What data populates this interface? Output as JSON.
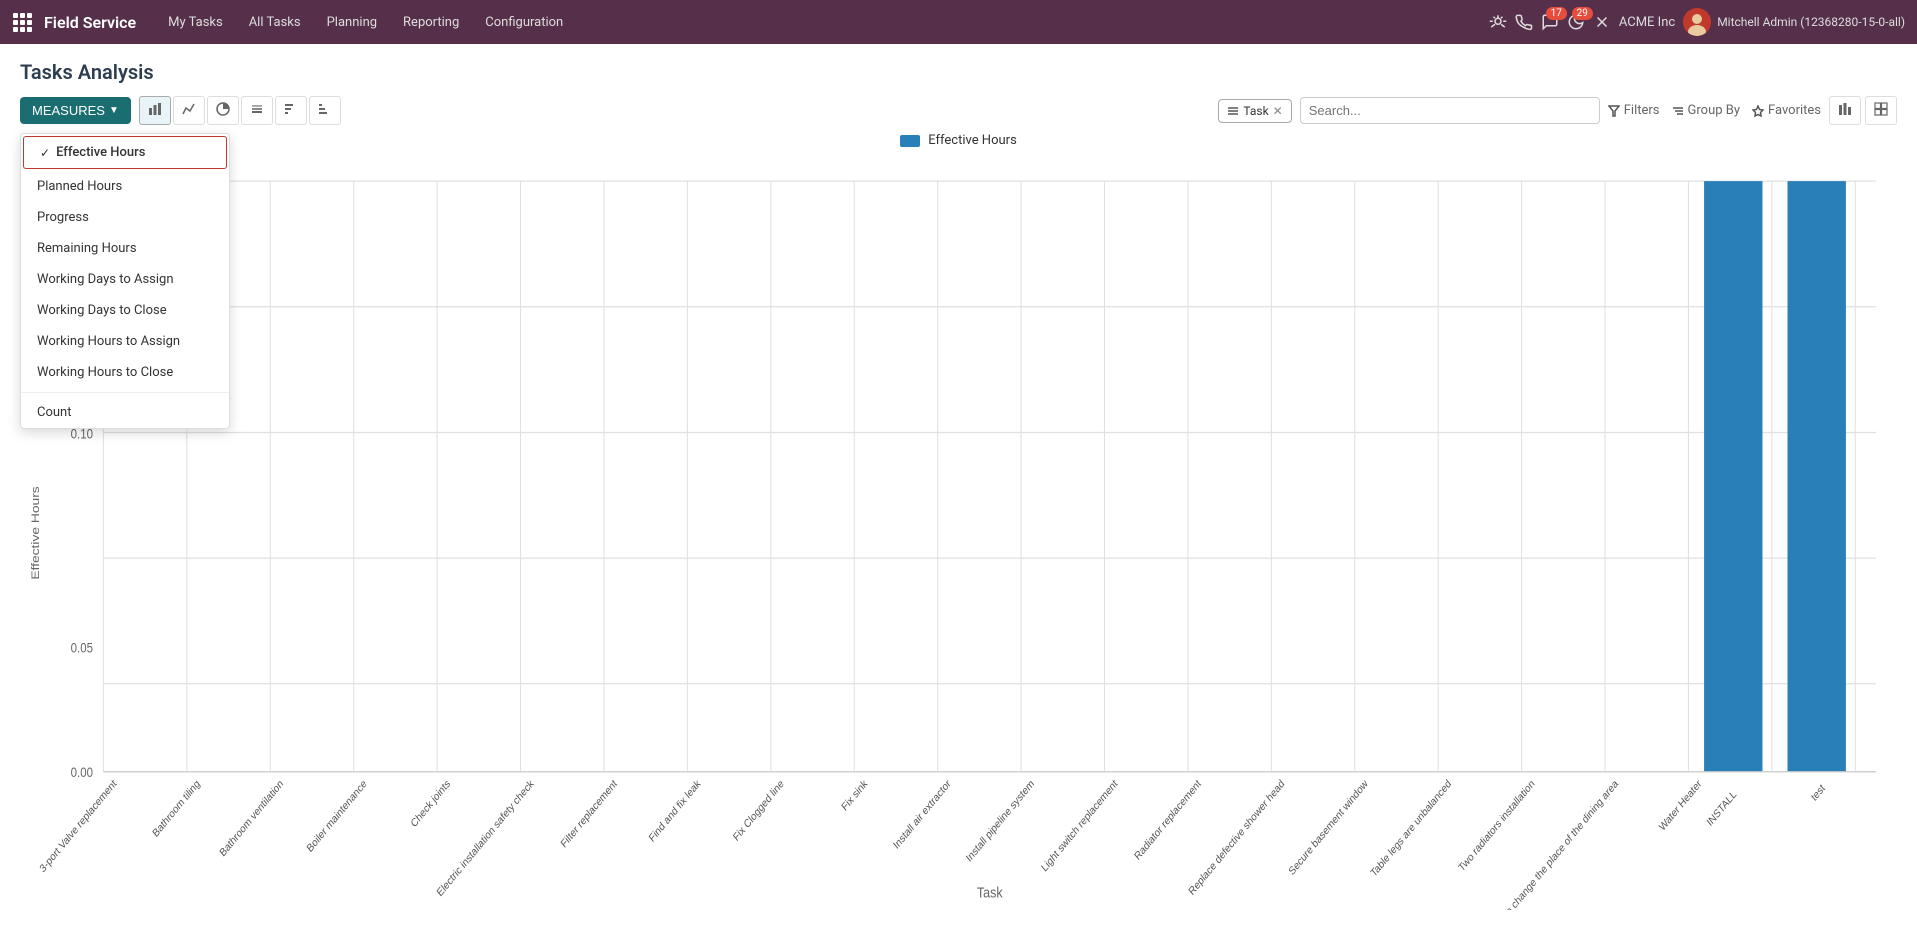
{
  "nav": {
    "app_icon": "grid-icon",
    "app_title": "Field Service",
    "links": [
      "My Tasks",
      "All Tasks",
      "Planning",
      "Reporting",
      "Configuration"
    ],
    "actions": {
      "bug_icon": "bug-icon",
      "phone_icon": "phone-icon",
      "chat_badge": "17",
      "moon_badge": "29",
      "close_icon": "close-icon",
      "company": "ACME Inc",
      "user": "Mitchell Admin (12368280-15-0-all)"
    }
  },
  "page": {
    "title": "Tasks Analysis"
  },
  "toolbar": {
    "measures_label": "MEASURES",
    "chart_types": [
      "bar-icon",
      "line-icon",
      "pie-icon",
      "stack-icon",
      "desc-sort-icon",
      "asc-sort-icon"
    ]
  },
  "filter_bar": {
    "tag_label": "Task",
    "search_placeholder": "Search...",
    "filters_label": "Filters",
    "group_by_label": "Group By",
    "favorites_label": "Favorites"
  },
  "dropdown": {
    "items": [
      {
        "label": "Effective Hours",
        "selected": true
      },
      {
        "label": "Planned Hours",
        "selected": false
      },
      {
        "label": "Progress",
        "selected": false
      },
      {
        "label": "Remaining Hours",
        "selected": false
      },
      {
        "label": "Working Days to Assign",
        "selected": false
      },
      {
        "label": "Working Days to Close",
        "selected": false
      },
      {
        "label": "Working Hours to Assign",
        "selected": false
      },
      {
        "label": "Working Hours to Close",
        "selected": false
      }
    ],
    "divider_items": [
      {
        "label": "Count",
        "selected": false
      }
    ]
  },
  "chart": {
    "legend_label": "Effective Hours",
    "legend_color": "#2980b9",
    "y_axis_label": "Effective Hours",
    "x_axis_label": "Task",
    "y_values": [
      0.0,
      0.05,
      0.1
    ],
    "bars": [
      {
        "label": "3-port Valve replacement",
        "value": 0
      },
      {
        "label": "Bathroom tiling",
        "value": 0
      },
      {
        "label": "Bathroom ventilation",
        "value": 0
      },
      {
        "label": "Boiler maintenance",
        "value": 0
      },
      {
        "label": "Check joints",
        "value": 0
      },
      {
        "label": "Electric installation safety check",
        "value": 0
      },
      {
        "label": "Filter replacement",
        "value": 0
      },
      {
        "label": "Find and fix leak",
        "value": 0
      },
      {
        "label": "Fix Clogged line",
        "value": 0
      },
      {
        "label": "Fix sink",
        "value": 0
      },
      {
        "label": "Install air extractor",
        "value": 0
      },
      {
        "label": "Install pipeline system",
        "value": 0
      },
      {
        "label": "Light switch replacement",
        "value": 0
      },
      {
        "label": "Radiator replacement",
        "value": 0
      },
      {
        "label": "Replace defective shower head",
        "value": 0
      },
      {
        "label": "Secure basement window",
        "value": 0
      },
      {
        "label": "Table legs are unbalanced",
        "value": 0
      },
      {
        "label": "Two radiators installation",
        "value": 0
      },
      {
        "label": "Want to change the place of the dining area",
        "value": 0
      },
      {
        "label": "Water Heater",
        "value": 0
      },
      {
        "label": "INSTALL",
        "value": 1.0
      },
      {
        "label": "test",
        "value": 1.0
      }
    ],
    "bar_color": "#2980b9"
  }
}
